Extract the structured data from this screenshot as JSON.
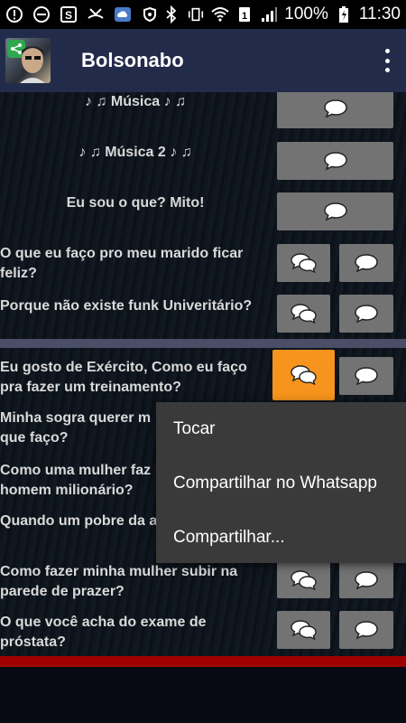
{
  "status_bar": {
    "battery": "100%",
    "time": "11:30",
    "left_icons": [
      "warning-icon",
      "do-not-disturb-icon",
      "s-notification-icon",
      "missed-call-icon",
      "cloud-icon",
      "shield-icon"
    ],
    "right_icons": [
      "bluetooth-icon",
      "vibrate-icon",
      "wifi-icon",
      "sim-icon",
      "signal-icon",
      "battery-charging-icon"
    ]
  },
  "app_bar": {
    "title": "Bolsonabo",
    "icon": "app-avatar-with-share-icon",
    "menu_icon": "overflow-menu-icon"
  },
  "rows": [
    {
      "label": "♪ ♫ Música ♪ ♫",
      "buttons": [
        "chat-bubble-icon"
      ]
    },
    {
      "label": "♪ ♫ Música 2 ♪ ♫",
      "buttons": [
        "chat-bubble-icon"
      ]
    },
    {
      "label": "Eu sou o que? Mito!",
      "buttons": [
        "chat-bubble-icon"
      ]
    },
    {
      "label": "O que eu faço pro meu marido ficar feliz?",
      "buttons": [
        "chat-bubbles-icon",
        "chat-bubble-icon"
      ]
    },
    {
      "label": "Porque não existe funk Univeritário?",
      "buttons": [
        "chat-bubbles-icon",
        "chat-bubble-icon"
      ]
    },
    {
      "label": "Eu gosto de Exército, Como eu faço pra fazer um treinamento?",
      "buttons": [
        "chat-bubbles-icon",
        "chat-bubble-icon"
      ],
      "active": true
    },
    {
      "label": "Minha sogra querer m que faço?",
      "buttons": []
    },
    {
      "label": "Como uma mulher faz homem milionário?",
      "buttons": []
    },
    {
      "label": "Quando um pobre da a",
      "buttons": []
    },
    {
      "label": "Como fazer minha mulher subir na parede de prazer?",
      "buttons": [
        "chat-bubbles-icon",
        "chat-bubble-icon"
      ]
    },
    {
      "label": "O que você acha do exame de próstata?",
      "buttons": [
        "chat-bubbles-icon",
        "chat-bubble-icon"
      ]
    }
  ],
  "popup_menu": {
    "items": [
      "Tocar",
      "Compartilhar no Whatsapp",
      "Compartilhar..."
    ]
  },
  "colors": {
    "app_bar": "#232b4a",
    "button": "#737373",
    "button_active": "#f7941d",
    "popup": "#3a3a3a",
    "accent_bar": "#a00000"
  }
}
